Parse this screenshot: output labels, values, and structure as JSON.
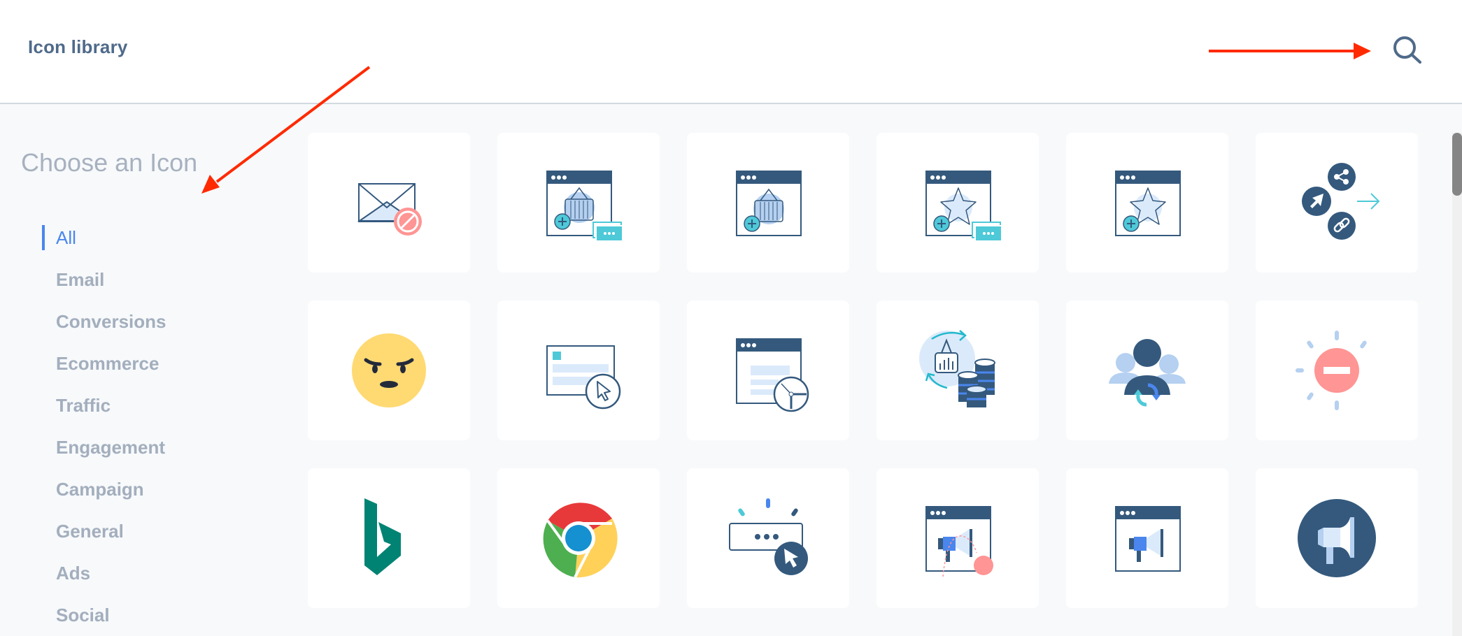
{
  "header": {
    "title": "Icon library",
    "search_icon": "search-icon"
  },
  "sidebar": {
    "title": "Choose an Icon",
    "categories": [
      {
        "label": "All",
        "active": true
      },
      {
        "label": "Email",
        "active": false
      },
      {
        "label": "Conversions",
        "active": false
      },
      {
        "label": "Ecommerce",
        "active": false
      },
      {
        "label": "Traffic",
        "active": false
      },
      {
        "label": "Engagement",
        "active": false
      },
      {
        "label": "Campaign",
        "active": false
      },
      {
        "label": "General",
        "active": false
      },
      {
        "label": "Ads",
        "active": false
      },
      {
        "label": "Social",
        "active": false
      }
    ]
  },
  "icons": [
    "email-blocked-icon",
    "browser-basket-add-tickets-icon",
    "browser-basket-add-icon",
    "browser-star-add-tickets-icon",
    "browser-star-add-icon",
    "share-click-link-icon",
    "angry-face-icon",
    "browser-form-click-icon",
    "browser-time-icon",
    "basket-coins-exchange-icon",
    "audience-sync-icon",
    "alert-minus-icon",
    "bing-logo-icon",
    "chrome-logo-icon",
    "input-click-icon",
    "browser-megaphone-ball-icon",
    "browser-megaphone-icon",
    "megaphone-circle-icon"
  ],
  "colors": {
    "navy": "#34597d",
    "accent_blue": "#4a86ee",
    "teal": "#4ec9d8",
    "light_blue": "#dbeafb",
    "pale_blue": "#b5d0f0",
    "coral": "#ff9594",
    "yellow": "#ffd972",
    "annotation_red": "#ff2a00"
  }
}
